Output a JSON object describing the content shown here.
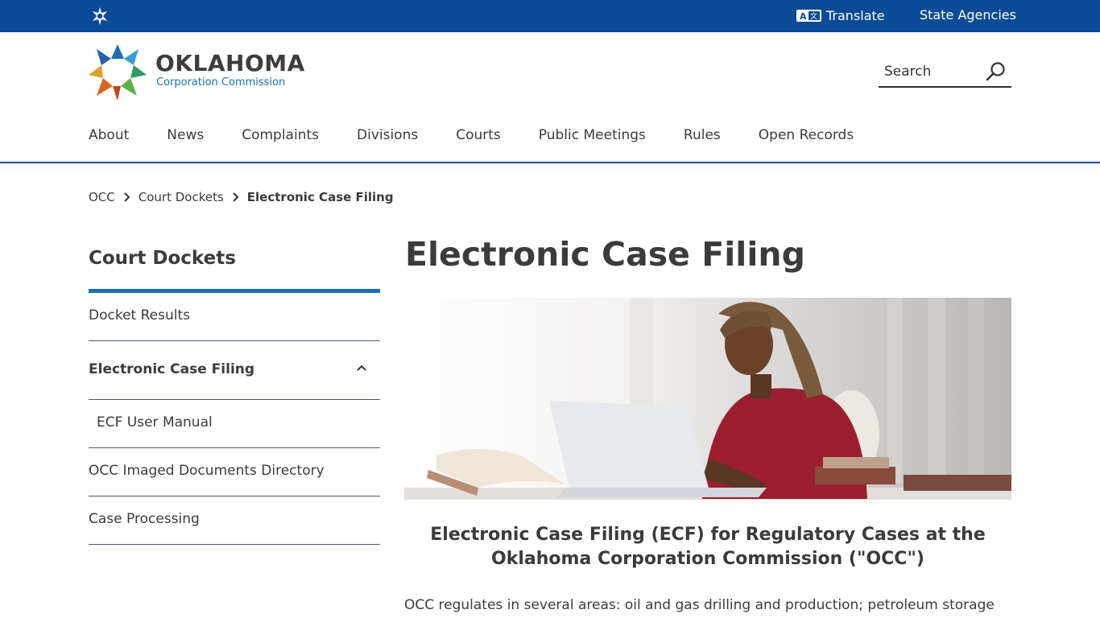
{
  "topbar": {
    "translate_label": "Translate",
    "agencies_label": "State Agencies",
    "bg_color": "#0a4b96"
  },
  "header": {
    "brand_name": "OKLAHOMA",
    "brand_sub": "Corporation Commission",
    "search_label": "Search"
  },
  "nav": {
    "items": [
      "About",
      "News",
      "Complaints",
      "Divisions",
      "Courts",
      "Public Meetings",
      "Rules",
      "Open Records"
    ]
  },
  "breadcrumb": {
    "items": [
      "OCC",
      "Court Dockets"
    ],
    "current": "Electronic Case Filing"
  },
  "sidebar": {
    "title": "Court Dockets",
    "items": [
      {
        "label": "Docket Results"
      },
      {
        "label": "Electronic Case Filing"
      },
      {
        "label": "ECF User Manual"
      },
      {
        "label": "OCC Imaged Documents Directory"
      },
      {
        "label": "Case Processing"
      }
    ],
    "accent_color": "#1a6fb0"
  },
  "main": {
    "title": "Electronic Case Filing",
    "subhead_line1": "Electronic Case Filing (ECF) for Regulatory Cases at the",
    "subhead_line2": "Oklahoma Corporation Commission (\"OCC\")",
    "paragraph": "OCC regulates in several areas: oil and gas drilling and production; petroleum storage"
  }
}
